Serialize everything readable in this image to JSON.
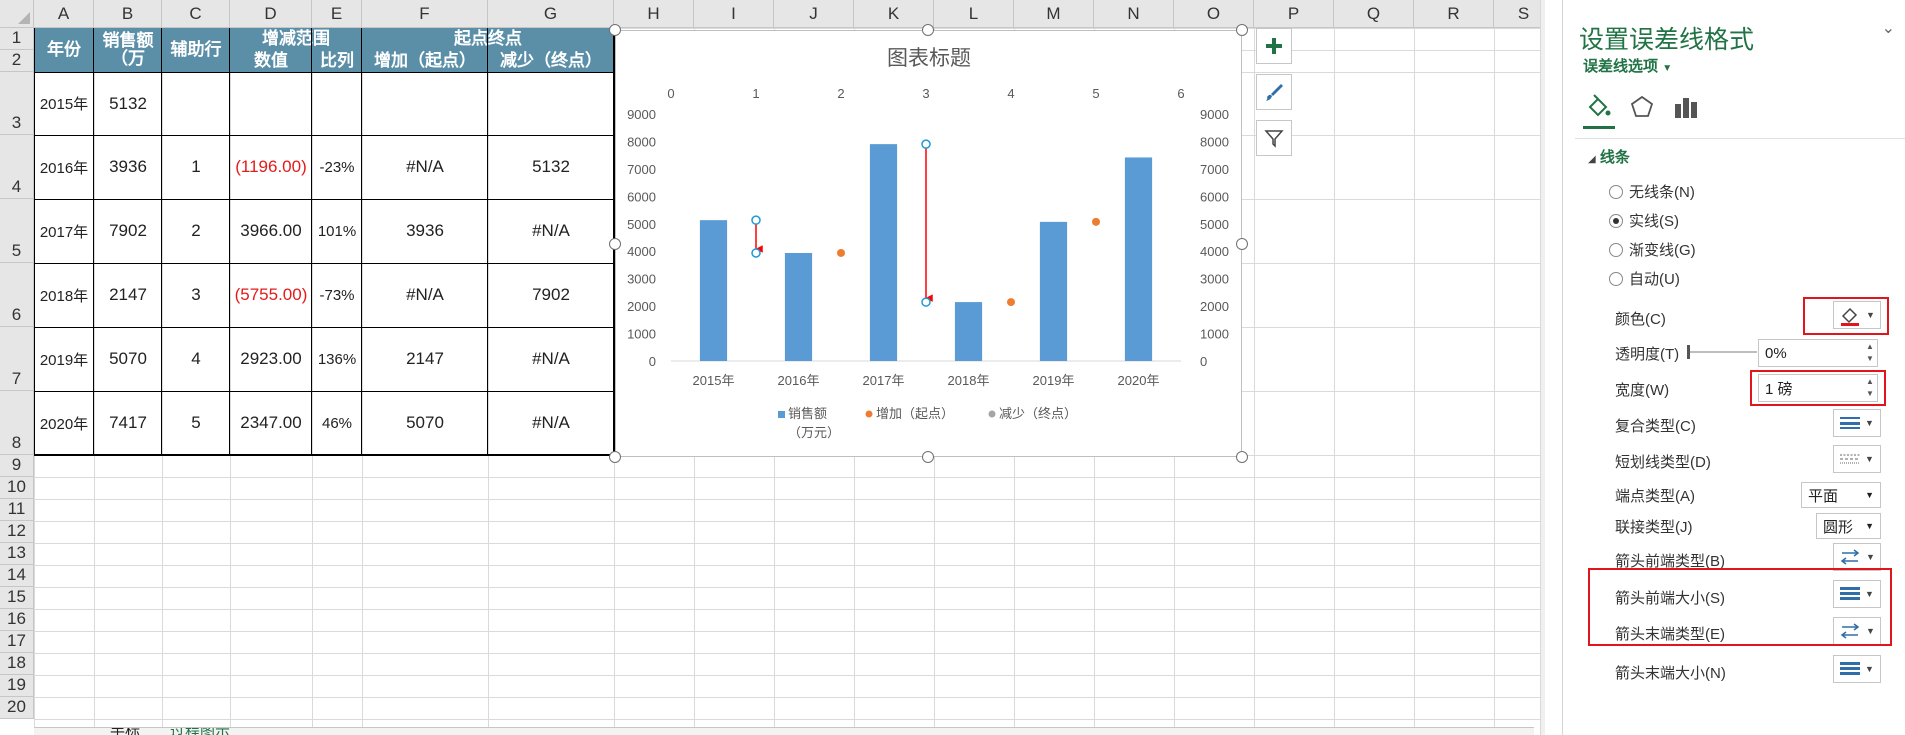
{
  "columns": [
    "A",
    "B",
    "C",
    "D",
    "E",
    "F",
    "G",
    "H",
    "I",
    "J",
    "K",
    "L",
    "M",
    "N",
    "O",
    "P",
    "Q",
    "R",
    "S"
  ],
  "rows": [
    "1",
    "2",
    "3",
    "4",
    "5",
    "6",
    "7",
    "8",
    "9",
    "10",
    "11",
    "12",
    "13",
    "14",
    "15",
    "16",
    "17",
    "18",
    "19",
    "20"
  ],
  "table": {
    "headers": {
      "year": "年份",
      "sales": "销售额（万",
      "aux": "辅助行",
      "range": "增减范围",
      "value": "数值",
      "ratio": "比列",
      "endpoint": "起点终点",
      "increase": "增加（起点）",
      "decrease": "减少（终点）"
    },
    "data_rows": [
      {
        "year": "2015年",
        "sales": "5132",
        "aux": "",
        "value": "",
        "ratio": "",
        "increase": "",
        "decrease": "",
        "negative": false
      },
      {
        "year": "2016年",
        "sales": "3936",
        "aux": "1",
        "value": "(1196.00)",
        "ratio": "-23%",
        "increase": "#N/A",
        "decrease": "5132",
        "negative": true
      },
      {
        "year": "2017年",
        "sales": "7902",
        "aux": "2",
        "value": "3966.00",
        "ratio": "101%",
        "increase": "3936",
        "decrease": "#N/A",
        "negative": false
      },
      {
        "year": "2018年",
        "sales": "2147",
        "aux": "3",
        "value": "(5755.00)",
        "ratio": "-73%",
        "increase": "#N/A",
        "decrease": "7902",
        "negative": true
      },
      {
        "year": "2019年",
        "sales": "5070",
        "aux": "4",
        "value": "2923.00",
        "ratio": "136%",
        "increase": "2147",
        "decrease": "#N/A",
        "negative": false
      },
      {
        "year": "2020年",
        "sales": "7417",
        "aux": "5",
        "value": "2347.00",
        "ratio": "46%",
        "increase": "5070",
        "decrease": "#N/A",
        "negative": false
      }
    ]
  },
  "sheet_tabs": [
    "手标",
    "过程图示"
  ],
  "chart_data": {
    "type": "bar",
    "title": "图表标题",
    "categories": [
      "2015年",
      "2016年",
      "2017年",
      "2018年",
      "2019年",
      "2020年"
    ],
    "series": [
      {
        "name": "销售额（万元）",
        "type": "bar",
        "values": [
          5132,
          3936,
          7902,
          2147,
          5070,
          7417
        ],
        "color": "#5b9bd5"
      },
      {
        "name": "增加（起点）",
        "type": "scatter",
        "x": [
          2,
          4,
          5
        ],
        "values": [
          3936,
          2147,
          5070
        ],
        "color": "#ed7d31"
      },
      {
        "name": "减少（终点）",
        "type": "scatter",
        "x": [
          1,
          3
        ],
        "values": [
          5132,
          7902
        ],
        "color": "#a5a5a5"
      }
    ],
    "error_bars": [
      {
        "x": 1,
        "from": 5132,
        "to": 3936,
        "color": "#ff0000"
      },
      {
        "x": 3,
        "from": 7902,
        "to": 2147,
        "color": "#ff0000"
      }
    ],
    "ylim": [
      0,
      9000
    ],
    "yticks": [
      "0",
      "1000",
      "2000",
      "3000",
      "4000",
      "5000",
      "6000",
      "7000",
      "8000",
      "9000"
    ],
    "secondary_ylim": [
      0,
      9000
    ],
    "secondary_xlim": [
      0,
      6
    ],
    "secondary_xticks": [
      "0",
      "1",
      "2",
      "3",
      "4",
      "5",
      "6"
    ],
    "legend": [
      "销售额",
      "（万元）",
      "增加（起点）",
      "减少（终点）"
    ],
    "legend_position": "bottom"
  },
  "chart_tools": {
    "add_icon": "plus-icon",
    "style_icon": "brush-icon",
    "filter_icon": "filter-icon"
  },
  "pane": {
    "title": "设置误差线格式",
    "subtitle": "误差线选项",
    "close": "⌄",
    "section": "线条",
    "radios": [
      {
        "label": "无线条(N)",
        "checked": false
      },
      {
        "label": "实线(S)",
        "checked": true
      },
      {
        "label": "渐变线(G)",
        "checked": false
      },
      {
        "label": "自动(U)",
        "checked": false
      }
    ],
    "color_label": "颜色(C)",
    "transparency_label": "透明度(T)",
    "transparency_value": "0%",
    "width_label": "宽度(W)",
    "width_value": "1 磅",
    "compound_label": "复合类型(C)",
    "dash_label": "短划线类型(D)",
    "cap_label": "端点类型(A)",
    "cap_value": "平面",
    "join_label": "联接类型(J)",
    "join_value": "圆形",
    "arrow_begin_type_label": "箭头前端类型(B)",
    "arrow_begin_size_label": "箭头前端大小(S)",
    "arrow_end_type_label": "箭头末端类型(E)",
    "arrow_end_size_label": "箭头末端大小(N)",
    "accent": "#217346",
    "highlight": "#e0161b"
  }
}
